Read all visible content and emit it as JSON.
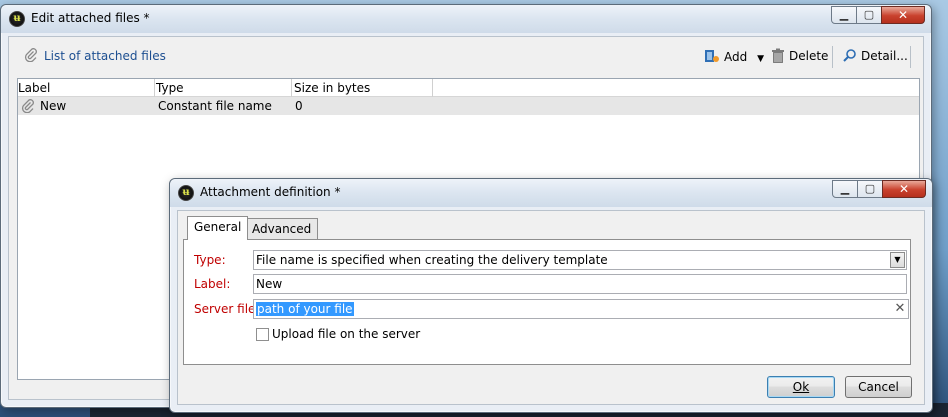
{
  "main_window": {
    "title": "Edit attached files *",
    "toolbar": {
      "list_label": "List of attached files",
      "add_label": "Add",
      "delete_label": "Delete",
      "detail_label": "Detail..."
    },
    "table": {
      "columns": [
        "Label",
        "Type",
        "Size in bytes"
      ],
      "rows": [
        {
          "label": "New",
          "type": "Constant file name",
          "size": "0"
        }
      ]
    }
  },
  "dialog": {
    "title": "Attachment definition *",
    "tabs": [
      {
        "label": "General",
        "active": true
      },
      {
        "label": "Advanced",
        "active": false
      }
    ],
    "fields": {
      "type_label": "Type:",
      "type_value": "File name is specified when creating the delivery template",
      "label_label": "Label:",
      "label_value": "New",
      "server_file_label": "Server file:",
      "server_file_value": "path of your file",
      "upload_label": "Upload file on the server",
      "upload_checked": false
    },
    "buttons": {
      "ok_label": "Ok",
      "cancel_label": "Cancel"
    }
  },
  "icons": {
    "app": "app-logo-icon",
    "paperclip": "paperclip-icon",
    "add": "add-icon",
    "dropdown": "chevron-down-icon",
    "delete": "trash-icon",
    "detail": "magnifier-icon"
  },
  "colors": {
    "required_label": "#c00000",
    "link_title": "#1d4f91",
    "selection": "#3399ff"
  }
}
